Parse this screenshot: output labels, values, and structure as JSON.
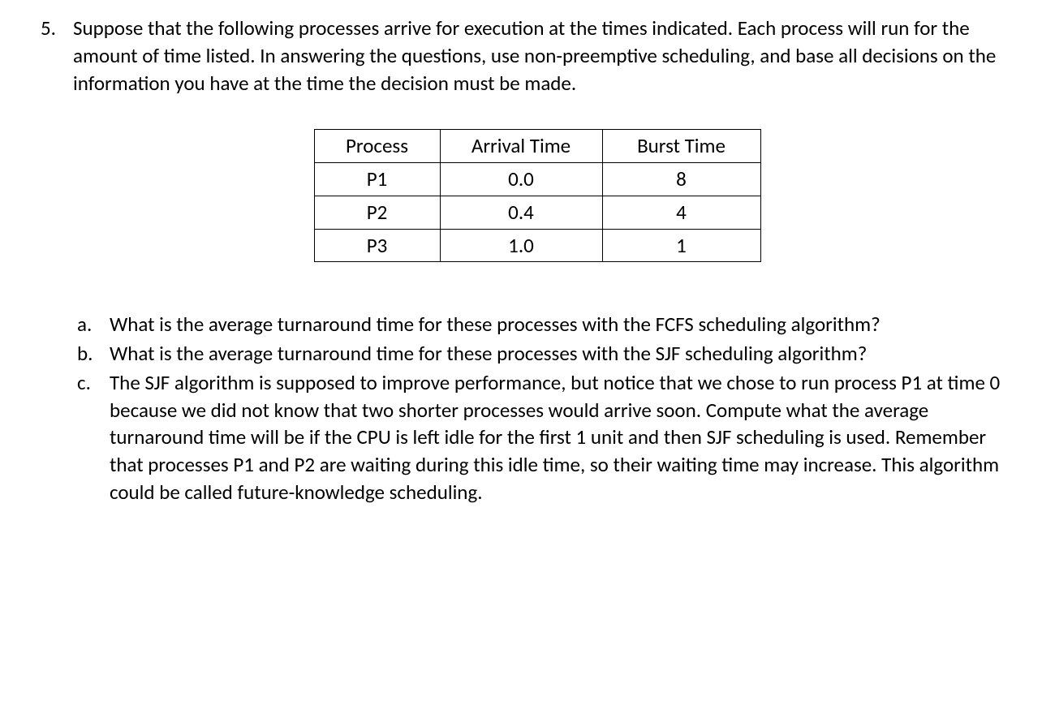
{
  "question_number": "5.",
  "main_text": "Suppose that the following processes arrive for execution at the times indicated. Each process will run for the amount of time listed. In answering the questions, use non-preemptive scheduling, and base all decisions on the information you have at the time the decision must be made.",
  "table": {
    "headers": [
      "Process",
      "Arrival Time",
      "Burst Time"
    ],
    "rows": [
      [
        "P1",
        "0.0",
        "8"
      ],
      [
        "P2",
        "0.4",
        "4"
      ],
      [
        "P3",
        "1.0",
        "1"
      ]
    ]
  },
  "subitems": [
    {
      "label": "a.",
      "text": "What is the average turnaround time for these processes with the FCFS scheduling algorithm?"
    },
    {
      "label": "b.",
      "text": "What is the average turnaround time for these processes with the SJF scheduling algorithm?"
    },
    {
      "label": "c.",
      "text": "The SJF algorithm is supposed to improve performance, but notice that we chose to run process P1 at time 0 because we did not know that two shorter processes would arrive soon. Compute what the average turnaround time will be if the CPU is left idle for the first 1 unit and then SJF scheduling is used. Remember that processes P1 and P2 are waiting during this idle time, so their waiting time may increase. This algorithm could be called future-knowledge scheduling."
    }
  ]
}
